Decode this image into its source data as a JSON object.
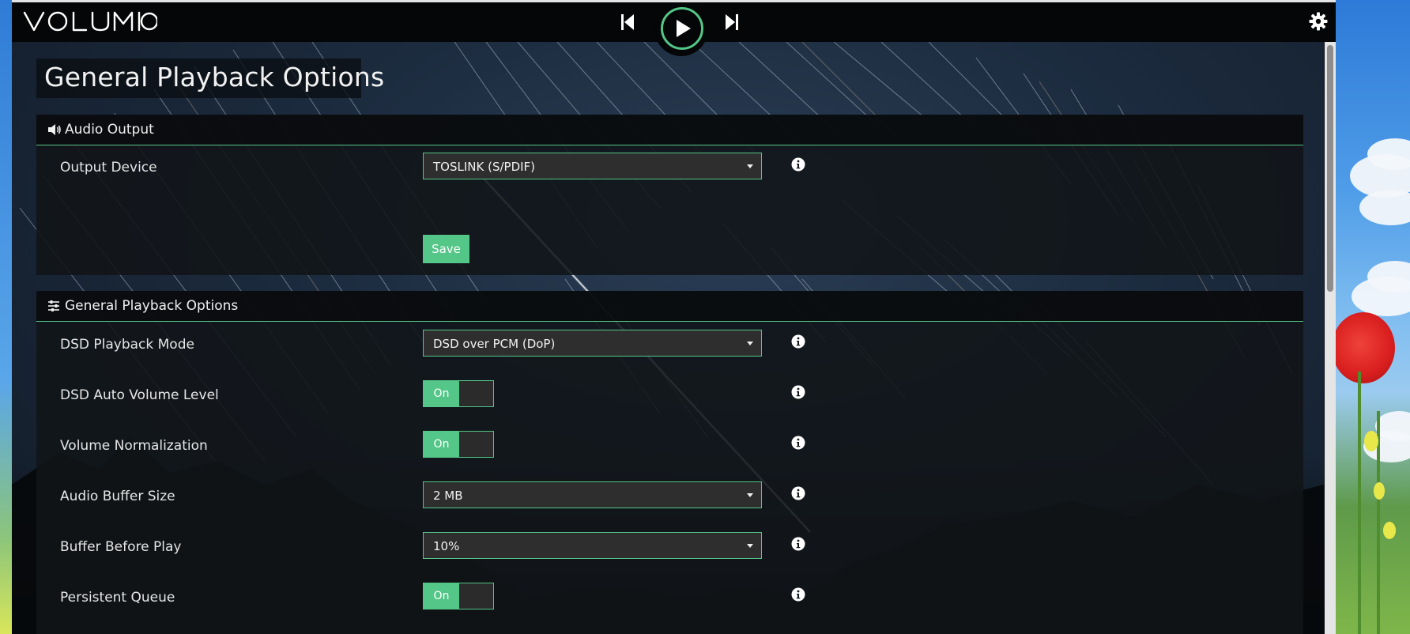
{
  "header": {
    "logo_text": "VOLUMIO",
    "prev_icon": "skip-previous-icon",
    "play_icon": "play-icon",
    "next_icon": "skip-next-icon",
    "settings_icon": "gear-icon"
  },
  "page": {
    "title": "General Playback Options"
  },
  "audio_output": {
    "heading": "Audio Output",
    "icon": "speaker-icon",
    "output_device": {
      "label": "Output Device",
      "value": "TOSLINK (S/PDIF)"
    },
    "save_label": "Save"
  },
  "playback_options": {
    "heading": "General Playback Options",
    "icon": "sliders-icon",
    "dsd_mode": {
      "label": "DSD Playback Mode",
      "value": "DSD over PCM (DoP)"
    },
    "dsd_auto_volume": {
      "label": "DSD Auto Volume Level",
      "state": "On"
    },
    "volume_normalization": {
      "label": "Volume Normalization",
      "state": "On"
    },
    "buffer_size": {
      "label": "Audio Buffer Size",
      "value": "2 MB"
    },
    "buffer_before_play": {
      "label": "Buffer Before Play",
      "value": "10%"
    },
    "persistent_queue": {
      "label": "Persistent Queue",
      "state": "On"
    }
  },
  "colors": {
    "accent": "#54c688",
    "topbar": "#050607",
    "panel": "#111418"
  }
}
